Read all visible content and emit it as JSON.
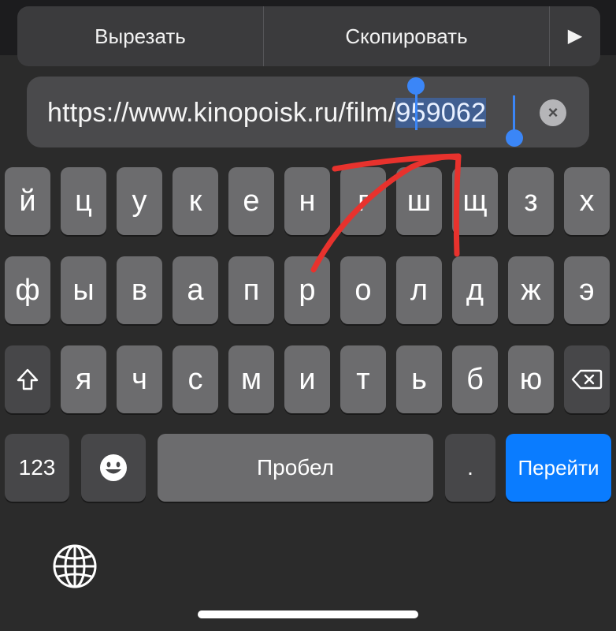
{
  "edit_menu": {
    "cut_label": "Вырезать",
    "copy_label": "Скопировать",
    "more_symbol": "▶"
  },
  "url_bar": {
    "prefix": "https://www.kinopoisk.ru/film/",
    "selected": "959062",
    "clear_symbol": "×"
  },
  "keyboard": {
    "row1": [
      "й",
      "ц",
      "у",
      "к",
      "е",
      "н",
      "г",
      "ш",
      "щ",
      "з",
      "х"
    ],
    "row2": [
      "ф",
      "ы",
      "в",
      "а",
      "п",
      "р",
      "о",
      "л",
      "д",
      "ж",
      "э"
    ],
    "row3": [
      "я",
      "ч",
      "с",
      "м",
      "и",
      "т",
      "ь",
      "б",
      "ю"
    ],
    "numbers_label": "123",
    "space_label": "Пробел",
    "period_label": ".",
    "go_label": "Перейти"
  },
  "colors": {
    "accent": "#0a7cff",
    "selection": "#3b86f7",
    "annotation": "#e8322d"
  },
  "icons": {
    "shift": "shift-icon",
    "backspace": "backspace-icon",
    "emoji": "emoji-icon",
    "globe": "globe-icon"
  }
}
